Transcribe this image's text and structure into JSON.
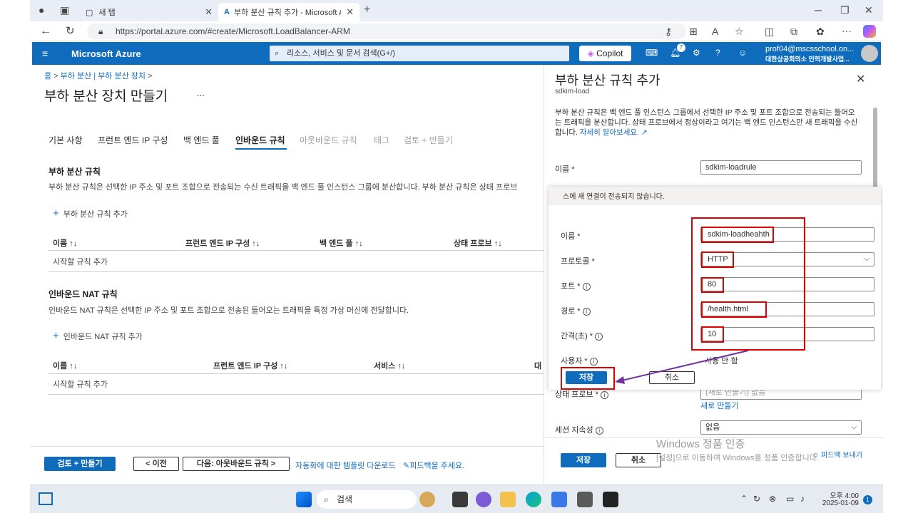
{
  "browser": {
    "tabs": [
      {
        "label": "새 탭"
      },
      {
        "label": "부하 분산 규칙 추가 - Microsoft A"
      }
    ],
    "url": "https://portal.azure.com/#create/Microsoft.LoadBalancer-ARM"
  },
  "azure": {
    "brand": "Microsoft Azure",
    "search_placeholder": "리소스, 서비스 및 문서 검색(G+/)",
    "copilot": "Copilot",
    "notif_count": "7",
    "account_email": "prof04@mscsschool.on...",
    "account_org": "대한상공회의소 인력개발사업..."
  },
  "main": {
    "breadcrumb": [
      "홈",
      "부하 분산 | 부하 분산 장치"
    ],
    "title": "부하 분산 장치 만들기",
    "more": "...",
    "tabs": [
      "기본 사항",
      "프런트 엔드 IP 구성",
      "백 엔드 풀",
      "인바운드 규칙",
      "아웃바운드 규칙",
      "태그",
      "검토 + 만들기"
    ],
    "lb_rules": {
      "title": "부하 분산 규칙",
      "desc": "부하 분산 규칙은 선택한 IP 주소 및 포트 조합으로 전송되는 수신 트래픽을 백 엔드 풀 인스턴스 그룹에 분산합니다. 부하 분산 규칙은 상태 프로브",
      "add": "부하 분산 규칙 추가",
      "columns": [
        "이름 ↑↓",
        "프런트 엔드 IP 구성 ↑↓",
        "백 엔드 풀 ↑↓",
        "상태 프로브 ↑↓"
      ],
      "empty": "시작할 규칙 추가"
    },
    "nat_rules": {
      "title": "인바운드 NAT 규칙",
      "desc": "인바운드 NAT 규칙은 선택한 IP 주소 및 포트 조합으로 전송된 들어오는 트래픽을 특정 가상 머신에 전달합니다.",
      "add": "인바운드 NAT 규칙 추가",
      "columns": [
        "이름 ↑↓",
        "프런트 엔드 IP 구성 ↑↓",
        "서비스 ↑↓",
        "대"
      ],
      "empty": "시작할 규칙 추가"
    },
    "footer": {
      "review": "검토 + 만들기",
      "prev": "< 이전",
      "next": "다음: 아웃바운드 규칙 >",
      "template_link": "자동화에 대한 템플릿 다운로드",
      "feedback": "피드백을 주세요."
    }
  },
  "panel": {
    "title": "부하 분산 규칙 추가",
    "subtitle": "sdkim-load",
    "desc": "부하 분산 규칙은 백 엔드 풀 인스턴스 그룹에서 선택한 IP 주소 및 포트 조합으로 전송되는 들어오는 트래픽을 분산합니다. 상태 프로브에서 정상이라고 여기는 백 엔드 인스턴스만 새 트래픽을 수신합니다.",
    "learn_more": "자세히 알아보세요.",
    "name_label": "이름 *",
    "name_value": "sdkim-loadrule",
    "health_probe_label": "상태 프로브 *",
    "health_probe_value": "(새로 만들기) 없음",
    "create_new": "새로 만들기",
    "session_label": "세션 지속성",
    "session_value": "없음",
    "save": "저장",
    "cancel": "취소",
    "feedback": "피드백 보내기"
  },
  "dialog": {
    "top_text": "스에 새 연결이 전송되지 않습니다.",
    "fields": [
      {
        "label": "이름 *",
        "value": "sdkim-loadheahth"
      },
      {
        "label": "프로토콜 *",
        "value": "HTTP"
      },
      {
        "label": "포트 *",
        "value": "80"
      },
      {
        "label": "경로 *",
        "value": "/health.html"
      },
      {
        "label": "간격(초) *",
        "value": "10"
      },
      {
        "label": "사용자 *",
        "value": "사용 안 함"
      }
    ],
    "save": "저장",
    "cancel": "취소"
  },
  "watermark": {
    "line1": "Windows 정품 인증",
    "line2": "[설정]으로 이동하여 Windows를 정품 인증합니다."
  },
  "taskbar": {
    "search": "검색",
    "time": "오후 4:00",
    "date": "2025-01-09",
    "badge": "1"
  }
}
